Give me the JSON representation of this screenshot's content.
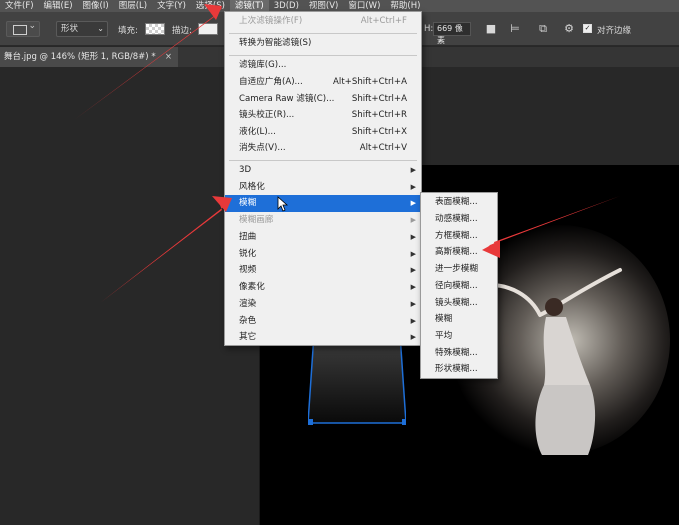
{
  "menubar": {
    "items": [
      {
        "label": "文件(F)",
        "active": false
      },
      {
        "label": "编辑(E)",
        "active": false
      },
      {
        "label": "图像(I)",
        "active": false
      },
      {
        "label": "图层(L)",
        "active": false
      },
      {
        "label": "文字(Y)",
        "active": false
      },
      {
        "label": "选择(S)",
        "active": false
      },
      {
        "label": "滤镜(T)",
        "active": true
      },
      {
        "label": "3D(D)",
        "active": false
      },
      {
        "label": "视图(V)",
        "active": false
      },
      {
        "label": "窗口(W)",
        "active": false
      },
      {
        "label": "帮助(H)",
        "active": false
      }
    ]
  },
  "options": {
    "shape_mode": "形状",
    "fill_label": "填充:",
    "stroke_label": "描边:",
    "height_label": "H:",
    "height_value": "669 像素",
    "align_edges_label": "对齐边缘",
    "align_edges_checked": true
  },
  "document": {
    "tab_title": "舞台.jpg @ 146% (矩形 1, RGB/8#) *",
    "close_glyph": "×"
  },
  "filter_menu": {
    "rows": [
      {
        "label": "上次滤镜操作(F)",
        "shortcut": "Alt+Ctrl+F",
        "disabled": true
      },
      {
        "label": "转换为智能滤镜(S)",
        "shortcut": ""
      },
      {
        "label": "滤镜库(G)...",
        "shortcut": ""
      },
      {
        "label": "自适应广角(A)...",
        "shortcut": "Alt+Shift+Ctrl+A"
      },
      {
        "label": "Camera Raw 滤镜(C)...",
        "shortcut": "Shift+Ctrl+A"
      },
      {
        "label": "镜头校正(R)...",
        "shortcut": "Shift+Ctrl+R"
      },
      {
        "label": "液化(L)...",
        "shortcut": "Shift+Ctrl+X"
      },
      {
        "label": "消失点(V)...",
        "shortcut": "Alt+Ctrl+V"
      },
      {
        "label": "3D",
        "submenu": true
      },
      {
        "label": "风格化",
        "submenu": true
      },
      {
        "label": "模糊",
        "submenu": true,
        "highlighted": true
      },
      {
        "label": "模糊画廊",
        "submenu": true,
        "disabled": true
      },
      {
        "label": "扭曲",
        "submenu": true
      },
      {
        "label": "锐化",
        "submenu": true
      },
      {
        "label": "视频",
        "submenu": true
      },
      {
        "label": "像素化",
        "submenu": true
      },
      {
        "label": "渲染",
        "submenu": true
      },
      {
        "label": "杂色",
        "submenu": true
      },
      {
        "label": "其它",
        "submenu": true
      }
    ]
  },
  "blur_menu": {
    "rows": [
      {
        "label": "表面模糊..."
      },
      {
        "label": "动感模糊..."
      },
      {
        "label": "方框模糊..."
      },
      {
        "label": "高斯模糊..."
      },
      {
        "label": "进一步模糊"
      },
      {
        "label": "径向模糊..."
      },
      {
        "label": "镜头模糊..."
      },
      {
        "label": "模糊"
      },
      {
        "label": "平均"
      },
      {
        "label": "特殊模糊..."
      },
      {
        "label": "形状模糊..."
      }
    ]
  },
  "colors": {
    "highlight": "#1e6fd8",
    "annotation_arrow": "#e8393a",
    "path_handle": "#1e6fd8"
  },
  "icons": {
    "submenu_arrow": "▶",
    "check": "✓"
  }
}
